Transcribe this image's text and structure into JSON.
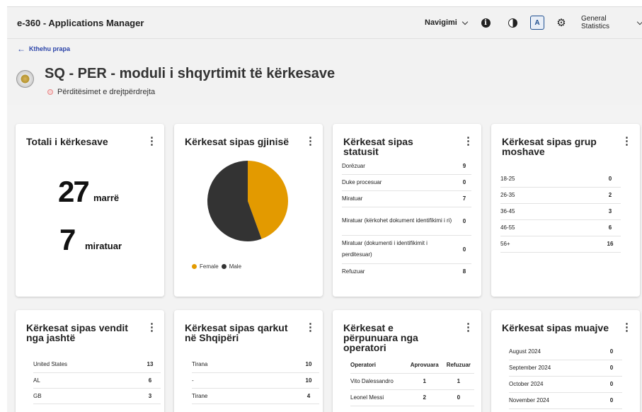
{
  "app": {
    "title": "e-360 - Applications Manager"
  },
  "topbar": {
    "nav_label": "Navigimi",
    "stats_label": "General Statistics",
    "icons": [
      "info-icon",
      "contrast-icon",
      "translate-icon",
      "gear-icon"
    ]
  },
  "header": {
    "back_label": "Kthehu prapa",
    "title": "SQ - PER - moduli i shqyrtimit të kërkesave",
    "subtitle": "Përditësimet e drejtpërdrejta"
  },
  "cards": {
    "total": {
      "title": "Totali i kërkesave",
      "received_value": "27",
      "received_label": "marrë",
      "approved_value": "7",
      "approved_label": "miratuar"
    },
    "gender": {
      "title": "Kërkesat sipas gjinisë",
      "legend_female": "Female",
      "legend_male": "Male"
    },
    "status": {
      "title": "Kërkesat sipas statusit",
      "rows": [
        {
          "label": "Dorëzuar",
          "value": "9"
        },
        {
          "label": "Duke procesuar",
          "value": "0"
        },
        {
          "label": "Miratuar",
          "value": "7"
        },
        {
          "label": "Miratuar (kërkohet dokument identifikimi i ri)",
          "value": "0"
        },
        {
          "label": "Miratuar (dokumenti i identifikimit i perditesuar)",
          "value": "0"
        },
        {
          "label": "Refuzuar",
          "value": "8"
        }
      ]
    },
    "age": {
      "title": "Kërkesat sipas grup moshave",
      "rows": [
        {
          "label": "18-25",
          "value": "0"
        },
        {
          "label": "26-35",
          "value": "2"
        },
        {
          "label": "36-45",
          "value": "3"
        },
        {
          "label": "46-55",
          "value": "6"
        },
        {
          "label": "56+",
          "value": "16"
        }
      ]
    },
    "country": {
      "title": "Kërkesat sipas vendit nga jashtë",
      "rows": [
        {
          "label": "United States",
          "value": "13"
        },
        {
          "label": "AL",
          "value": "6"
        },
        {
          "label": "GB",
          "value": "3"
        }
      ]
    },
    "county": {
      "title": "Kërkesat sipas qarkut në Shqipëri",
      "rows": [
        {
          "label": "Tirana",
          "value": "10"
        },
        {
          "label": "-",
          "value": "10"
        },
        {
          "label": "Tirane",
          "value": "4"
        }
      ]
    },
    "operator": {
      "title": "Kërkesat e përpunuara nga operatori",
      "headers": [
        "Operatori",
        "Aprovuara",
        "Refuzuar"
      ],
      "rows": [
        {
          "name": "Vito Dalessandro",
          "approved": "1",
          "rejected": "1"
        },
        {
          "name": "Leonel Messi",
          "approved": "2",
          "rejected": "0"
        }
      ]
    },
    "month": {
      "title": "Kërkesat sipas muajve",
      "rows": [
        {
          "label": "August 2024",
          "value": "0"
        },
        {
          "label": "September 2024",
          "value": "0"
        },
        {
          "label": "October 2024",
          "value": "0"
        },
        {
          "label": "November 2024",
          "value": "0"
        }
      ]
    }
  },
  "chart_data": {
    "type": "pie",
    "title": "Kërkesat sipas gjinisë",
    "slices": [
      {
        "label": "Female",
        "value": 12,
        "color": "#e39a00"
      },
      {
        "label": "Male",
        "value": 15,
        "color": "#333333"
      }
    ],
    "legend": "bottom-left"
  }
}
